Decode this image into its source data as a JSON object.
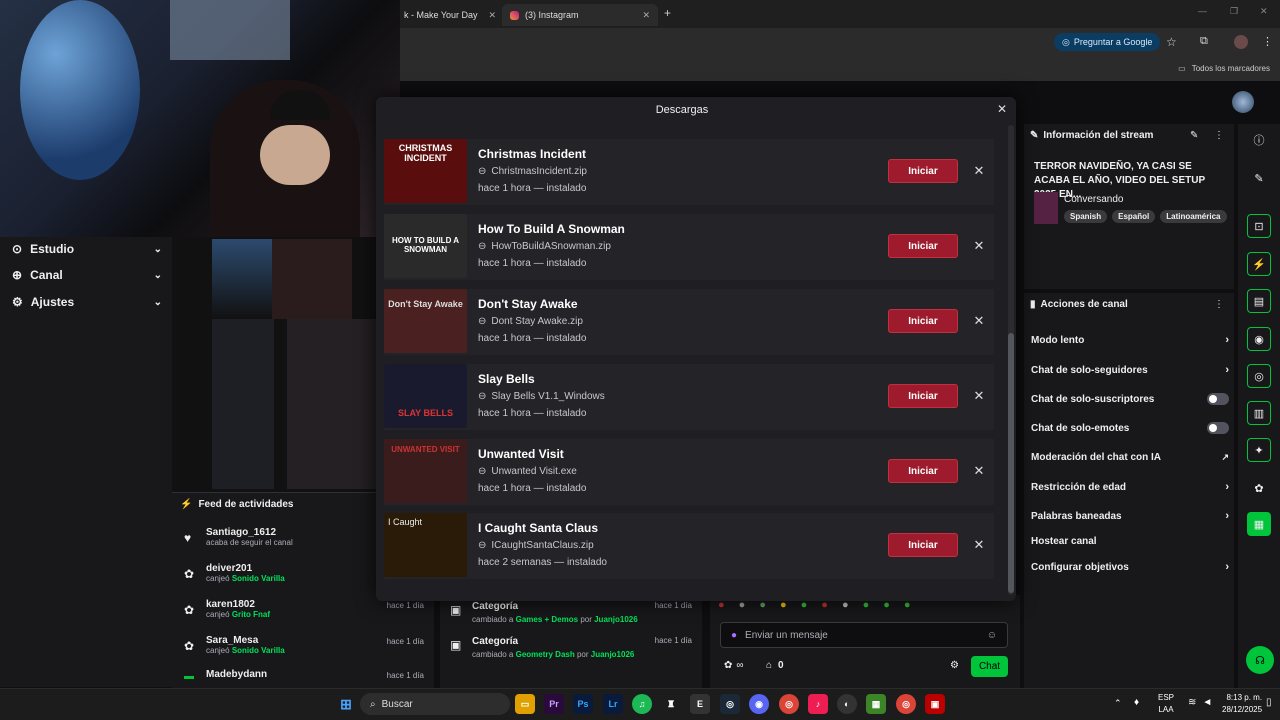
{
  "browser": {
    "tabs": [
      {
        "label": "k - Make Your Day"
      },
      {
        "label": "(3) Instagram"
      }
    ],
    "ask_google": "Preguntar a Google",
    "bookmarks_label": "Todos los marcadores"
  },
  "left_nav": {
    "items": [
      {
        "label": "Estudio"
      },
      {
        "label": "Canal"
      },
      {
        "label": "Ajustes"
      }
    ]
  },
  "activity_feed": {
    "title": "Feed de actividades",
    "rows": [
      {
        "name": "Santiago_1612",
        "action": "acaba de seguir el canal",
        "reward": "",
        "time": ""
      },
      {
        "name": "deiver201",
        "action": "canjeó",
        "reward": "Sonido Varilla",
        "time": ""
      },
      {
        "name": "karen1802",
        "action": "canjeó",
        "reward": "Grito Fnaf",
        "time": "hace 1 día"
      },
      {
        "name": "Sara_Mesa",
        "action": "canjeó",
        "reward": "Sonido Varilla",
        "time": "hace 1 día"
      },
      {
        "name": "Madebydann",
        "action": "",
        "reward": "",
        "time": "hace 1 día"
      }
    ]
  },
  "category_feed": {
    "rows": [
      {
        "title": "Categoría",
        "text": "cambiado a",
        "value": "Games + Demos",
        "by": "por",
        "user": "Juanjo1026",
        "time": "hace 1 día"
      },
      {
        "title": "Categoría",
        "text": "cambiado a",
        "value": "Geometry Dash",
        "by": "por",
        "user": "Juanjo1026",
        "time": "hace 1 día"
      }
    ]
  },
  "chat": {
    "placeholder": "Enviar un mensaje",
    "points": "0",
    "send_label": "Chat"
  },
  "stream_info": {
    "title": "Información del stream",
    "stream_title": "TERROR NAVIDEÑO, YA CASI SE ACABA EL AÑO, VIDEO DEL SETUP 2025 EN...",
    "category": "Conversando",
    "tags": [
      "Spanish",
      "Español",
      "Latinoamérica"
    ]
  },
  "channel_actions": {
    "title": "Acciones de canal",
    "items": [
      {
        "label": "Modo lento",
        "control": "chevron"
      },
      {
        "label": "Chat de solo-seguidores",
        "control": "chevron"
      },
      {
        "label": "Chat de solo-suscriptores",
        "control": "toggle"
      },
      {
        "label": "Chat de solo-emotes",
        "control": "toggle"
      },
      {
        "label": "Moderación del chat con IA",
        "control": "external"
      },
      {
        "label": "Restricción de edad",
        "control": "chevron"
      },
      {
        "label": "Palabras baneadas",
        "control": "chevron"
      },
      {
        "label": "Hostear canal",
        "control": "none"
      },
      {
        "label": "Configurar objetivos",
        "control": "chevron"
      }
    ]
  },
  "dialog": {
    "title": "Descargas",
    "downloads": [
      {
        "title": "Christmas Incident",
        "file": "ChristmasIncident.zip",
        "time": "hace 1 hora",
        "status": "instalado",
        "button": "Iniciar",
        "thumb_text": "CHRISTMAS INCIDENT",
        "thumb_color": "#5a0d0d"
      },
      {
        "title": "How To Build A Snowman",
        "file": "HowToBuildASnowman.zip",
        "time": "hace 1 hora",
        "status": "instalado",
        "button": "Iniciar",
        "thumb_text": "HOW TO BUILD A SNOWMAN",
        "thumb_color": "#2a2a2a"
      },
      {
        "title": "Don't Stay Awake",
        "file": "Dont Stay Awake.zip",
        "time": "hace 1 hora",
        "status": "instalado",
        "button": "Iniciar",
        "thumb_text": "Don't Stay Awake",
        "thumb_color": "#4a2020"
      },
      {
        "title": "Slay Bells",
        "file": "Slay Bells V1.1_Windows",
        "time": "hace 1 hora",
        "status": "instalado",
        "button": "Iniciar",
        "thumb_text": "SLAY BELLS",
        "thumb_color": "#1a1a2e"
      },
      {
        "title": "Unwanted Visit",
        "file": "Unwanted Visit.exe",
        "time": "hace 1 hora",
        "status": "instalado",
        "button": "Iniciar",
        "thumb_text": "UNWANTED VISIT",
        "thumb_color": "#3a1c1c"
      },
      {
        "title": "I Caught Santa Claus",
        "file": "ICaughtSantaClaus.zip",
        "time": "hace 2 semanas",
        "status": "instalado",
        "button": "Iniciar",
        "thumb_text": "I Caught",
        "thumb_color": "#2a1a08"
      }
    ]
  },
  "taskbar": {
    "search_label": "Buscar",
    "lang_top": "ESP",
    "lang_bottom": "LAA",
    "time": "8:13 p. m.",
    "date": "28/12/2025"
  },
  "colors": {
    "accent_green": "#00c53b",
    "button_red": "#9d1b2c",
    "panel_bg": "#18181b"
  }
}
